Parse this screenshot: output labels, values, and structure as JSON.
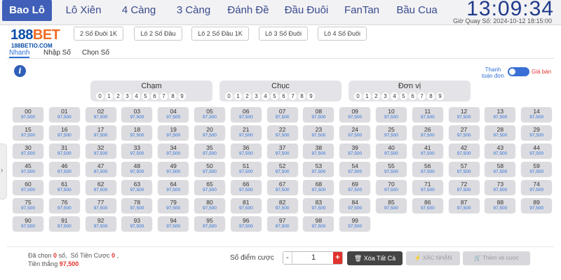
{
  "nav": {
    "tabs": [
      {
        "label": "Bao Lô",
        "active": true
      },
      {
        "label": "Lô Xiên"
      },
      {
        "label": "4 Càng"
      },
      {
        "label": "3 Càng"
      },
      {
        "label": "Đánh Đề"
      },
      {
        "label": "Đầu Đuôi"
      },
      {
        "label": "FanTan"
      },
      {
        "label": "Bầu Cua"
      }
    ],
    "clock": "13:09:34",
    "draw_time": "Giờ Quay Số: 2024-10-12 18:15:00"
  },
  "logo": {
    "brand_main": "188",
    "brand_accent": "BET",
    "domain": "188BETIO.COM"
  },
  "subtabs": [
    "2 Số Đuôi 1K",
    "Lô 2 Số Đầu",
    "Lô 2 Số Đầu 1K",
    "Lô 3 Số Đuôi",
    "Lô 4 Số Đuôi"
  ],
  "modes": [
    {
      "label": "Nhanh",
      "active": true
    },
    {
      "label": "Nhập Số"
    },
    {
      "label": "Chọn Số"
    }
  ],
  "toggle": {
    "left_label": "Thanh toán đơn",
    "right_label": "Giá bán"
  },
  "groups": [
    {
      "title": "Chạm",
      "digits": [
        "0",
        "1",
        "2",
        "3",
        "4",
        "5",
        "6",
        "7",
        "8",
        "9"
      ]
    },
    {
      "title": "Chục",
      "digits": [
        "0",
        "1",
        "2",
        "3",
        "4",
        "5",
        "6",
        "7",
        "8",
        "9"
      ]
    },
    {
      "title": "Đơn vị",
      "digits": [
        "0",
        "1",
        "2",
        "3",
        "4",
        "5",
        "6",
        "7",
        "8",
        "9"
      ]
    }
  ],
  "numbers": {
    "price": "97,500",
    "count": 100
  },
  "footer": {
    "selected_prefix": "Đã chọn",
    "selected_count": "0",
    "selected_suffix": "số,",
    "bet_label": "Số Tiền Cược",
    "bet_value": "0",
    "bet_suffix": ",",
    "win_label": "Tiền thắng",
    "win_value": "97,500",
    "points_label": "Số điểm cược",
    "points_value": "1",
    "minus": "-",
    "plus": "+",
    "clear_label": "Xóa Tất Cả",
    "confirm_label": "XÁC NHẬN",
    "add_label": "Thêm vé cược"
  },
  "colors": {
    "accent": "#3f5fb8",
    "price_blue": "#2f6fd6",
    "danger": "#e0332e"
  }
}
